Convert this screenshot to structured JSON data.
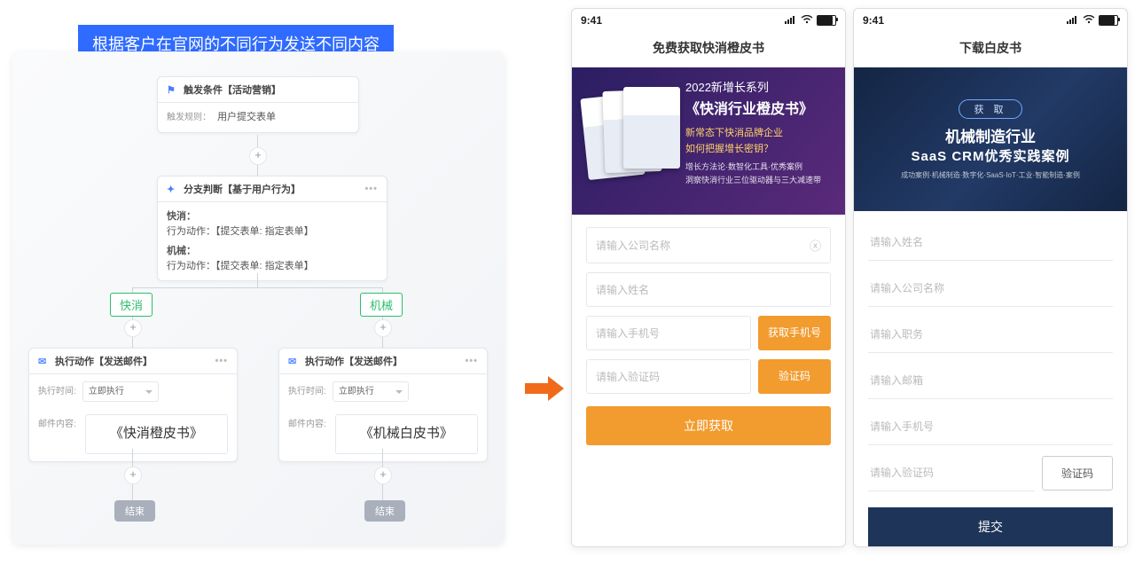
{
  "caption": "根据客户在官网的不同行为发送不同内容",
  "flow": {
    "trigger": {
      "title": "触发条件【活动营销】",
      "rule_label": "触发规则：",
      "rule_value": "用户提交表单"
    },
    "branch": {
      "title": "分支判断【基于用户行为】",
      "g1_label": "快消：",
      "g1_action": "行为动作：【提交表单: 指定表单】",
      "g2_label": "机械：",
      "g2_action": "行为动作：【提交表单: 指定表单】",
      "tag_left": "快消",
      "tag_right": "机械"
    },
    "exec": {
      "title": "执行动作【发送邮件】",
      "when_label": "执行时间:",
      "when_value": "立即执行",
      "content_label": "邮件内容:",
      "doc_left": "《快消橙皮书》",
      "doc_right": "《机械白皮书》"
    },
    "end": "结束"
  },
  "statusbar": {
    "time": "9:41"
  },
  "phone1": {
    "title": "免费获取快消橙皮书",
    "hero": {
      "line1": "2022新增长系列",
      "line2": "《快消行业橙皮书》",
      "line3": "新常态下快消品牌企业",
      "line4": "如何把握增长密钥？",
      "line5a": "增长方法论·数智化工具·优秀案例",
      "line5b": "洞察快消行业三位驱动器与三大减速带"
    },
    "inputs": {
      "company_ph": "请输入公司名称",
      "name_ph": "请输入姓名",
      "phone_ph": "请输入手机号",
      "phone_btn": "获取手机号",
      "code_ph": "请输入验证码",
      "code_btn": "验证码",
      "submit": "立即获取"
    }
  },
  "phone2": {
    "title": "下载白皮书",
    "hero": {
      "pill": "获 取",
      "l1": "机械制造行业",
      "l2": "SaaS CRM优秀实践案例",
      "l3": "成功案例·机械制造·数字化·SaaS·IoT·工业·智能制造·案例"
    },
    "inputs": {
      "name_ph": "请输入姓名",
      "company_ph": "请输入公司名称",
      "job_ph": "请输入职务",
      "email_ph": "请输入邮箱",
      "phone_ph": "请输入手机号",
      "code_ph": "请输入验证码",
      "code_btn": "验证码",
      "submit": "提交"
    }
  }
}
